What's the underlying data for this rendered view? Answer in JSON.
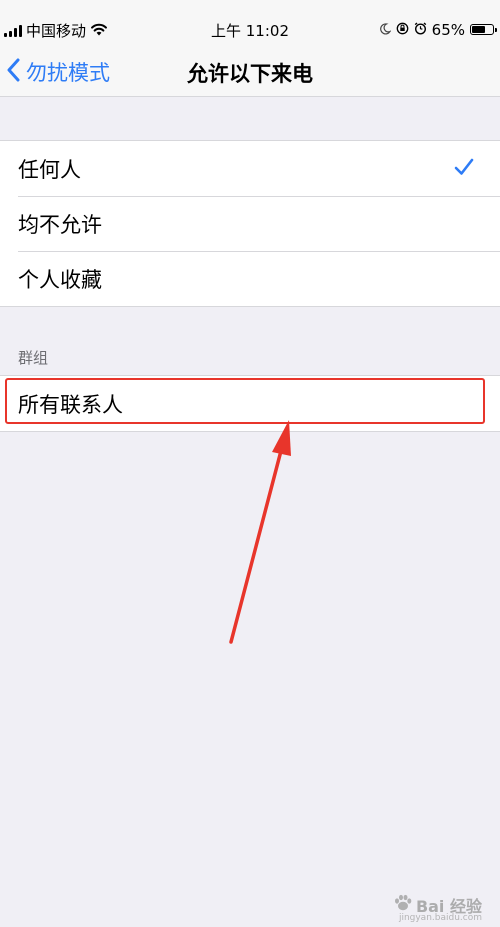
{
  "status_bar": {
    "carrier": "中国移动",
    "time": "上午 11:02",
    "battery_percent": "65%",
    "battery_level": 0.65
  },
  "nav": {
    "back_label": "勿扰模式",
    "title": "允许以下来电"
  },
  "options": [
    {
      "label": "任何人",
      "selected": true
    },
    {
      "label": "均不允许",
      "selected": false
    },
    {
      "label": "个人收藏",
      "selected": false
    }
  ],
  "groups_section": {
    "header": "群组",
    "items": [
      {
        "label": "所有联系人"
      }
    ]
  },
  "watermark": {
    "text": "Bai 经验",
    "sub": "jingyan.baidu.com"
  },
  "colors": {
    "accent": "#2e7cf6",
    "annotation": "#e8352b",
    "background": "#f0eff5"
  }
}
